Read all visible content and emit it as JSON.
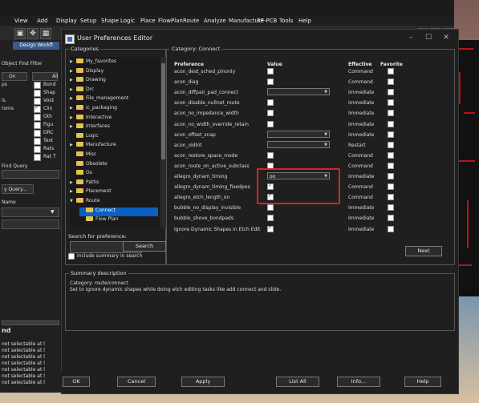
{
  "menu": [
    "View",
    "Add",
    "Display",
    "Setup",
    "Shape",
    "Logic",
    "Place",
    "FlowPlan",
    "Route",
    "Analyze",
    "Manufacture",
    "RF-PCB",
    "Tools",
    "Help"
  ],
  "background_panel": {
    "tab": "Design Workfl",
    "find_filter": "Object Find Filter",
    "on_btn": "On",
    "all_btn": "All",
    "side_labels": [
      "ps",
      "",
      "ls",
      "roms",
      "",
      "",
      "",
      "",
      "",
      ""
    ],
    "filter_items": [
      "Bond",
      "Shap",
      "Void",
      "Clin",
      "Oth",
      "Figu",
      "DRC",
      "Text",
      "Rats",
      "Rat T"
    ],
    "find_query": "Find Query",
    "query_btn": "y Query...",
    "name_label": "Name",
    "bottom_title": "nd",
    "log_lines": [
      "not selectable at l",
      "not selectable at l",
      "not selectable at l",
      "not selectable at l",
      "not selectable at l",
      "not selectable at l",
      "not selectable at l"
    ]
  },
  "dialog": {
    "title": "User Preferences Editor",
    "categories_legend": "Categories",
    "tree": [
      {
        "label": "My_favorites",
        "expand": "▶",
        "level": 0
      },
      {
        "label": "Display",
        "expand": "▶",
        "level": 0
      },
      {
        "label": "Drawing",
        "expand": "▶",
        "level": 0
      },
      {
        "label": "Drc",
        "expand": "▶",
        "level": 0
      },
      {
        "label": "File_management",
        "expand": "▶",
        "level": 0
      },
      {
        "label": "ic_packaging",
        "expand": "▶",
        "level": 0
      },
      {
        "label": "Interactive",
        "expand": "▶",
        "level": 0
      },
      {
        "label": "Interfaces",
        "expand": "▶",
        "level": 0
      },
      {
        "label": "Logic",
        "expand": "",
        "level": 0
      },
      {
        "label": "Manufacture",
        "expand": "▶",
        "level": 0
      },
      {
        "label": "Misc",
        "expand": "",
        "level": 0
      },
      {
        "label": "Obsolete",
        "expand": "",
        "level": 0
      },
      {
        "label": "Os",
        "expand": "",
        "level": 0
      },
      {
        "label": "Paths",
        "expand": "▶",
        "level": 0
      },
      {
        "label": "Placement",
        "expand": "▶",
        "level": 0
      },
      {
        "label": "Route",
        "expand": "▼",
        "level": 0
      },
      {
        "label": "Connect",
        "expand": "",
        "level": 1,
        "selected": true
      },
      {
        "label": "Flow Plan",
        "expand": "",
        "level": 1
      }
    ],
    "search_label": "Search for preference:",
    "search_value": "",
    "search_button": "Search",
    "include_summary": "Include summary in search",
    "category_legend": "Category:  Connect",
    "headers": {
      "preference": "Preference",
      "value": "Value",
      "effective": "Effective",
      "favorite": "Favorite"
    },
    "prefs": [
      {
        "name": "acon_dest_sched_pinonly",
        "type": "check",
        "checked": false,
        "effective": "Command"
      },
      {
        "name": "acon_diag",
        "type": "check",
        "checked": false,
        "effective": "Command"
      },
      {
        "name": "acon_diffpair_pad_connect",
        "type": "dropdown",
        "value": "",
        "effective": "Immediate"
      },
      {
        "name": "acon_disable_nullnet_route",
        "type": "check",
        "checked": false,
        "effective": "Immediate"
      },
      {
        "name": "acon_no_impedance_width",
        "type": "check",
        "checked": false,
        "effective": "Immediate"
      },
      {
        "name": "acon_no_width_override_retain",
        "type": "check",
        "checked": false,
        "effective": "Immediate"
      },
      {
        "name": "acon_offset_snap",
        "type": "dropdown",
        "value": "",
        "effective": "Immediate"
      },
      {
        "name": "acon_oldhit",
        "type": "dropdown",
        "value": "",
        "effective": "Restart"
      },
      {
        "name": "acon_restore_space_mode",
        "type": "check",
        "checked": false,
        "effective": "Command"
      },
      {
        "name": "acon_route_on_active_subclass",
        "type": "check",
        "checked": false,
        "effective": "Command"
      },
      {
        "name": "allegro_dynam_timing",
        "type": "dropdown",
        "value": "on",
        "effective": "Immediate"
      },
      {
        "name": "allegro_dynam_timing_fixedpos",
        "type": "check",
        "checked": true,
        "effective": "Command"
      },
      {
        "name": "allegro_etch_length_on",
        "type": "check",
        "checked": true,
        "effective": "Command"
      },
      {
        "name": "bubble_no_display_invisible",
        "type": "check",
        "checked": false,
        "effective": "Immediate"
      },
      {
        "name": "bubble_shove_bondpads",
        "type": "check",
        "checked": false,
        "effective": "Immediate"
      },
      {
        "name": "Ignore Dynamic Shapes in Etch Edit",
        "type": "check",
        "checked": true,
        "effective": "Immediate"
      }
    ],
    "next_button": "Next",
    "summary_legend": "Summary description",
    "summary_lines": [
      "Category: route/connect",
      "Set to ignore dynamic shapes while doing etch editing tasks like add connect and slide."
    ],
    "buttons": {
      "ok": "OK",
      "cancel": "Cancel",
      "apply": "Apply",
      "list_all": "List All",
      "info": "Info...",
      "help": "Help"
    }
  },
  "colors": {
    "highlight_box": "#e02020",
    "selection": "#0a5fc0"
  }
}
